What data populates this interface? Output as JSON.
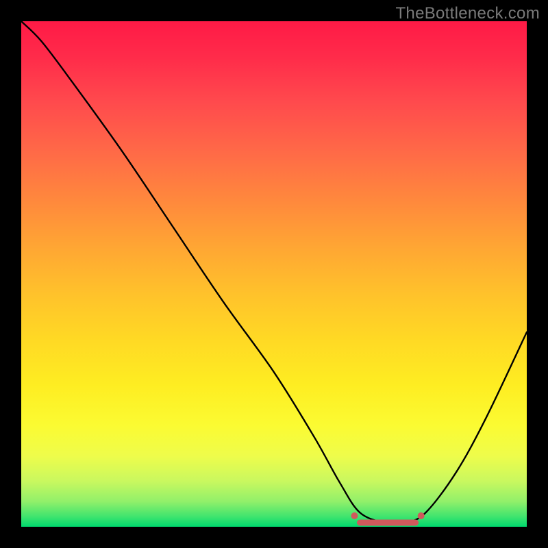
{
  "watermark": "TheBottleneck.com",
  "colors": {
    "frame": "#000000",
    "curve": "#000000",
    "flat_segment": "#cf595c"
  },
  "chart_data": {
    "type": "line",
    "title": "",
    "xlabel": "",
    "ylabel": "",
    "xlim": [
      0,
      100
    ],
    "ylim": [
      0,
      100
    ],
    "series": [
      {
        "name": "bottleneck-curve",
        "x": [
          0,
          4,
          10,
          20,
          30,
          40,
          50,
          58,
          63,
          67,
          72,
          76,
          80,
          86,
          92,
          100
        ],
        "y": [
          100,
          96,
          88,
          74,
          59,
          44,
          30,
          17,
          8,
          2,
          0,
          0,
          2,
          10,
          21,
          38
        ]
      }
    ],
    "flat_region": {
      "x_start": 67,
      "x_end": 78,
      "y": 0
    },
    "gradient_stops": [
      {
        "pos": 0,
        "color": "#ff1a46"
      },
      {
        "pos": 16,
        "color": "#ff4a4d"
      },
      {
        "pos": 36,
        "color": "#ff8a3c"
      },
      {
        "pos": 54,
        "color": "#ffc22b"
      },
      {
        "pos": 72,
        "color": "#feed22"
      },
      {
        "pos": 86,
        "color": "#eefc4b"
      },
      {
        "pos": 95,
        "color": "#91f06a"
      },
      {
        "pos": 100,
        "color": "#00d96e"
      }
    ]
  }
}
